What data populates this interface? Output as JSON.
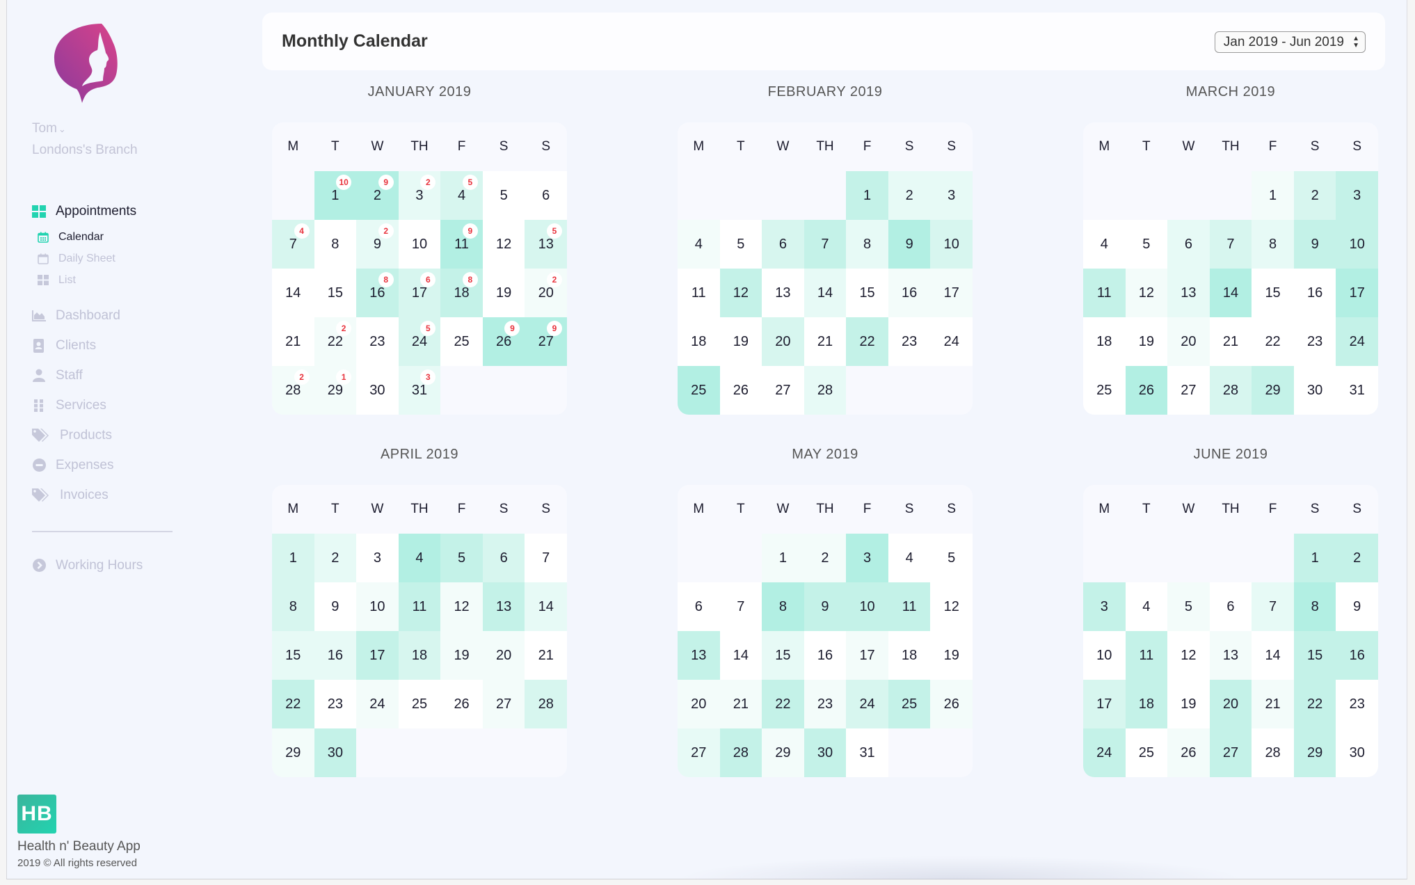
{
  "sidebar": {
    "user_name": "Tom",
    "branch": "Londons's Branch",
    "nav": {
      "appointments": "Appointments",
      "calendar": "Calendar",
      "daily_sheet": "Daily Sheet",
      "list": "List",
      "dashboard": "Dashboard",
      "clients": "Clients",
      "staff": "Staff",
      "services": "Services",
      "products": "Products",
      "expenses": "Expenses",
      "invoices": "Invoices",
      "working_hours": "Working Hours"
    },
    "footer": {
      "logo_text": "HB",
      "app_name": "Health n' Beauty App",
      "rights": "2019 © All rights reserved"
    }
  },
  "header": {
    "title": "Monthly Calendar",
    "range_selected": "Jan 2019 - Jun 2019"
  },
  "colors": {
    "accent": "#22d3b0",
    "badge_text": "#e8323c",
    "logo_magenta": "#c9408f",
    "heat_levels": [
      "#ffffff",
      "#f3fcfa",
      "#e7faf6",
      "#d7f6ef",
      "#c4f2e8",
      "#b2efe3"
    ]
  },
  "weekdays": [
    "M",
    "T",
    "W",
    "TH",
    "F",
    "S",
    "S"
  ],
  "months": [
    {
      "title": "JANUARY 2019",
      "offset": 1,
      "days": 31,
      "levels": [
        5,
        5,
        2,
        3,
        0,
        0,
        3,
        0,
        2,
        0,
        5,
        0,
        3,
        0,
        0,
        4,
        3,
        4,
        0,
        1,
        0,
        1,
        0,
        3,
        0,
        5,
        5,
        1,
        1,
        0,
        2
      ],
      "badges": {
        "1": "10",
        "2": "9",
        "3": "2",
        "4": "5",
        "7": "4",
        "9": "2",
        "11": "9",
        "13": "5",
        "16": "8",
        "17": "6",
        "18": "8",
        "20": "2",
        "22": "2",
        "24": "5",
        "26": "9",
        "27": "9",
        "28": "2",
        "29": "1",
        "31": "3"
      }
    },
    {
      "title": "FEBRUARY 2019",
      "offset": 4,
      "days": 28,
      "levels": [
        4,
        2,
        2,
        1,
        0,
        3,
        4,
        2,
        5,
        3,
        0,
        4,
        0,
        2,
        0,
        1,
        1,
        0,
        0,
        3,
        0,
        4,
        0,
        0,
        5,
        0,
        0,
        2
      ],
      "badges": {}
    },
    {
      "title": "MARCH 2019",
      "offset": 4,
      "days": 31,
      "levels": [
        1,
        3,
        4,
        0,
        0,
        2,
        3,
        2,
        4,
        4,
        4,
        1,
        2,
        5,
        0,
        0,
        5,
        0,
        0,
        1,
        0,
        0,
        0,
        4,
        0,
        5,
        0,
        3,
        4,
        0,
        0
      ],
      "badges": {}
    },
    {
      "title": "APRIL 2019",
      "offset": 0,
      "days": 30,
      "levels": [
        3,
        2,
        0,
        5,
        4,
        3,
        0,
        3,
        0,
        1,
        4,
        1,
        4,
        2,
        2,
        2,
        4,
        3,
        1,
        1,
        0,
        4,
        0,
        1,
        0,
        0,
        1,
        3,
        1,
        4
      ],
      "badges": {}
    },
    {
      "title": "MAY 2019",
      "offset": 2,
      "days": 31,
      "levels": [
        1,
        1,
        5,
        0,
        0,
        0,
        0,
        5,
        4,
        4,
        4,
        0,
        4,
        0,
        2,
        0,
        1,
        0,
        0,
        1,
        1,
        4,
        1,
        3,
        4,
        1,
        2,
        4,
        1,
        4,
        0
      ],
      "badges": {}
    },
    {
      "title": "JUNE 2019",
      "offset": 5,
      "days": 30,
      "levels": [
        4,
        4,
        4,
        0,
        1,
        0,
        2,
        5,
        0,
        0,
        4,
        0,
        1,
        0,
        4,
        4,
        3,
        4,
        0,
        4,
        1,
        4,
        0,
        4,
        0,
        1,
        4,
        0,
        4,
        0
      ],
      "badges": {}
    }
  ]
}
